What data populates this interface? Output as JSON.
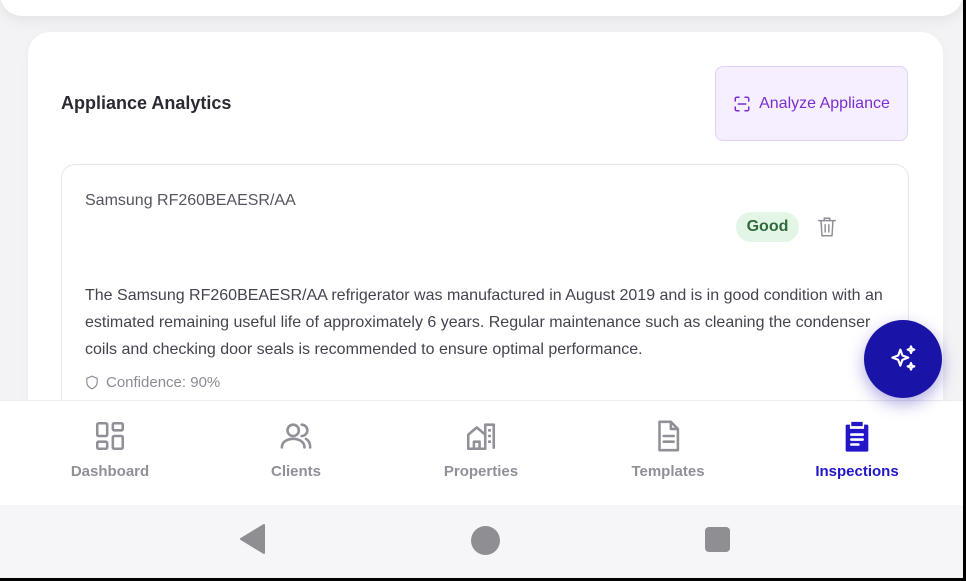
{
  "panel": {
    "title": "Appliance Analytics",
    "analyze_label": "Analyze Appliance"
  },
  "appliance": {
    "name": "Samsung RF260BEAESR/AA",
    "condition": "Good",
    "description": "The Samsung RF260BEAESR/AA refrigerator was manufactured in August 2019 and is in good condition with an estimated remaining useful life of approximately 6 years. Regular maintenance such as cleaning the condenser coils and checking door seals is recommended to ensure optimal performance.",
    "confidence": "Confidence: 90%"
  },
  "nav": {
    "items": [
      {
        "label": "Dashboard",
        "icon": "dashboard-icon"
      },
      {
        "label": "Clients",
        "icon": "users-icon"
      },
      {
        "label": "Properties",
        "icon": "building-icon"
      },
      {
        "label": "Templates",
        "icon": "document-icon"
      },
      {
        "label": "Inspections",
        "icon": "clipboard-icon",
        "active": true
      }
    ]
  },
  "colors": {
    "accent": "#2316c8",
    "fab": "#1a13a8",
    "analyze": "#7b2fd1",
    "badge_bg": "#e3f6e6",
    "badge_text": "#2e6a3a"
  }
}
